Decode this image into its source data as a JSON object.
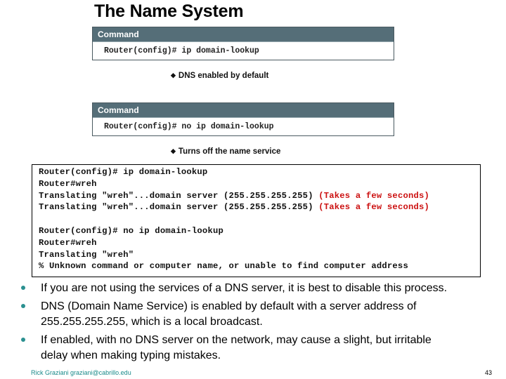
{
  "slide": {
    "title": "The Name System",
    "commands": [
      {
        "header": "Command",
        "text": "Router(config)# ip domain-lookup",
        "note": "DNS enabled by default"
      },
      {
        "header": "Command",
        "text": "Router(config)# no ip domain-lookup",
        "note": "Turns off the name service"
      }
    ],
    "note_bullet": "◆",
    "terminal": {
      "block1": [
        {
          "text": "Router(config)# ip domain-lookup",
          "comment": ""
        },
        {
          "text": "Router#wreh",
          "comment": ""
        },
        {
          "text": "Translating \"wreh\"...domain server (255.255.255.255) ",
          "comment": "(Takes a few seconds)"
        },
        {
          "text": "Translating \"wreh\"...domain server (255.255.255.255) ",
          "comment": "(Takes a few seconds)"
        }
      ],
      "block2": [
        {
          "text": "Router(config)# no ip domain-lookup"
        },
        {
          "text": "Router#wreh"
        },
        {
          "text": "Translating \"wreh\""
        },
        {
          "text": "% Unknown command or computer name, or unable to find computer address"
        }
      ]
    },
    "bullets": [
      {
        "lines": [
          "If you are not using the services of a DNS server, it is best to disable this process."
        ]
      },
      {
        "lines": [
          "DNS (Domain Name Service) is enabled by default with a server address of",
          "255.255.255.255, which is a local broadcast."
        ]
      },
      {
        "lines": [
          "If enabled, with no DNS server on the network, may cause a slight, but irritable",
          "delay when making typing mistakes."
        ]
      }
    ],
    "footer": {
      "author": "Rick Graziani  graziani@cabrillo.edu",
      "page_number": "43"
    },
    "colors": {
      "command_header": "#556e78",
      "bullet_dot": "#2a9090",
      "terminal_comment": "#cc1111",
      "footer_author": "#1a8a8a"
    }
  }
}
